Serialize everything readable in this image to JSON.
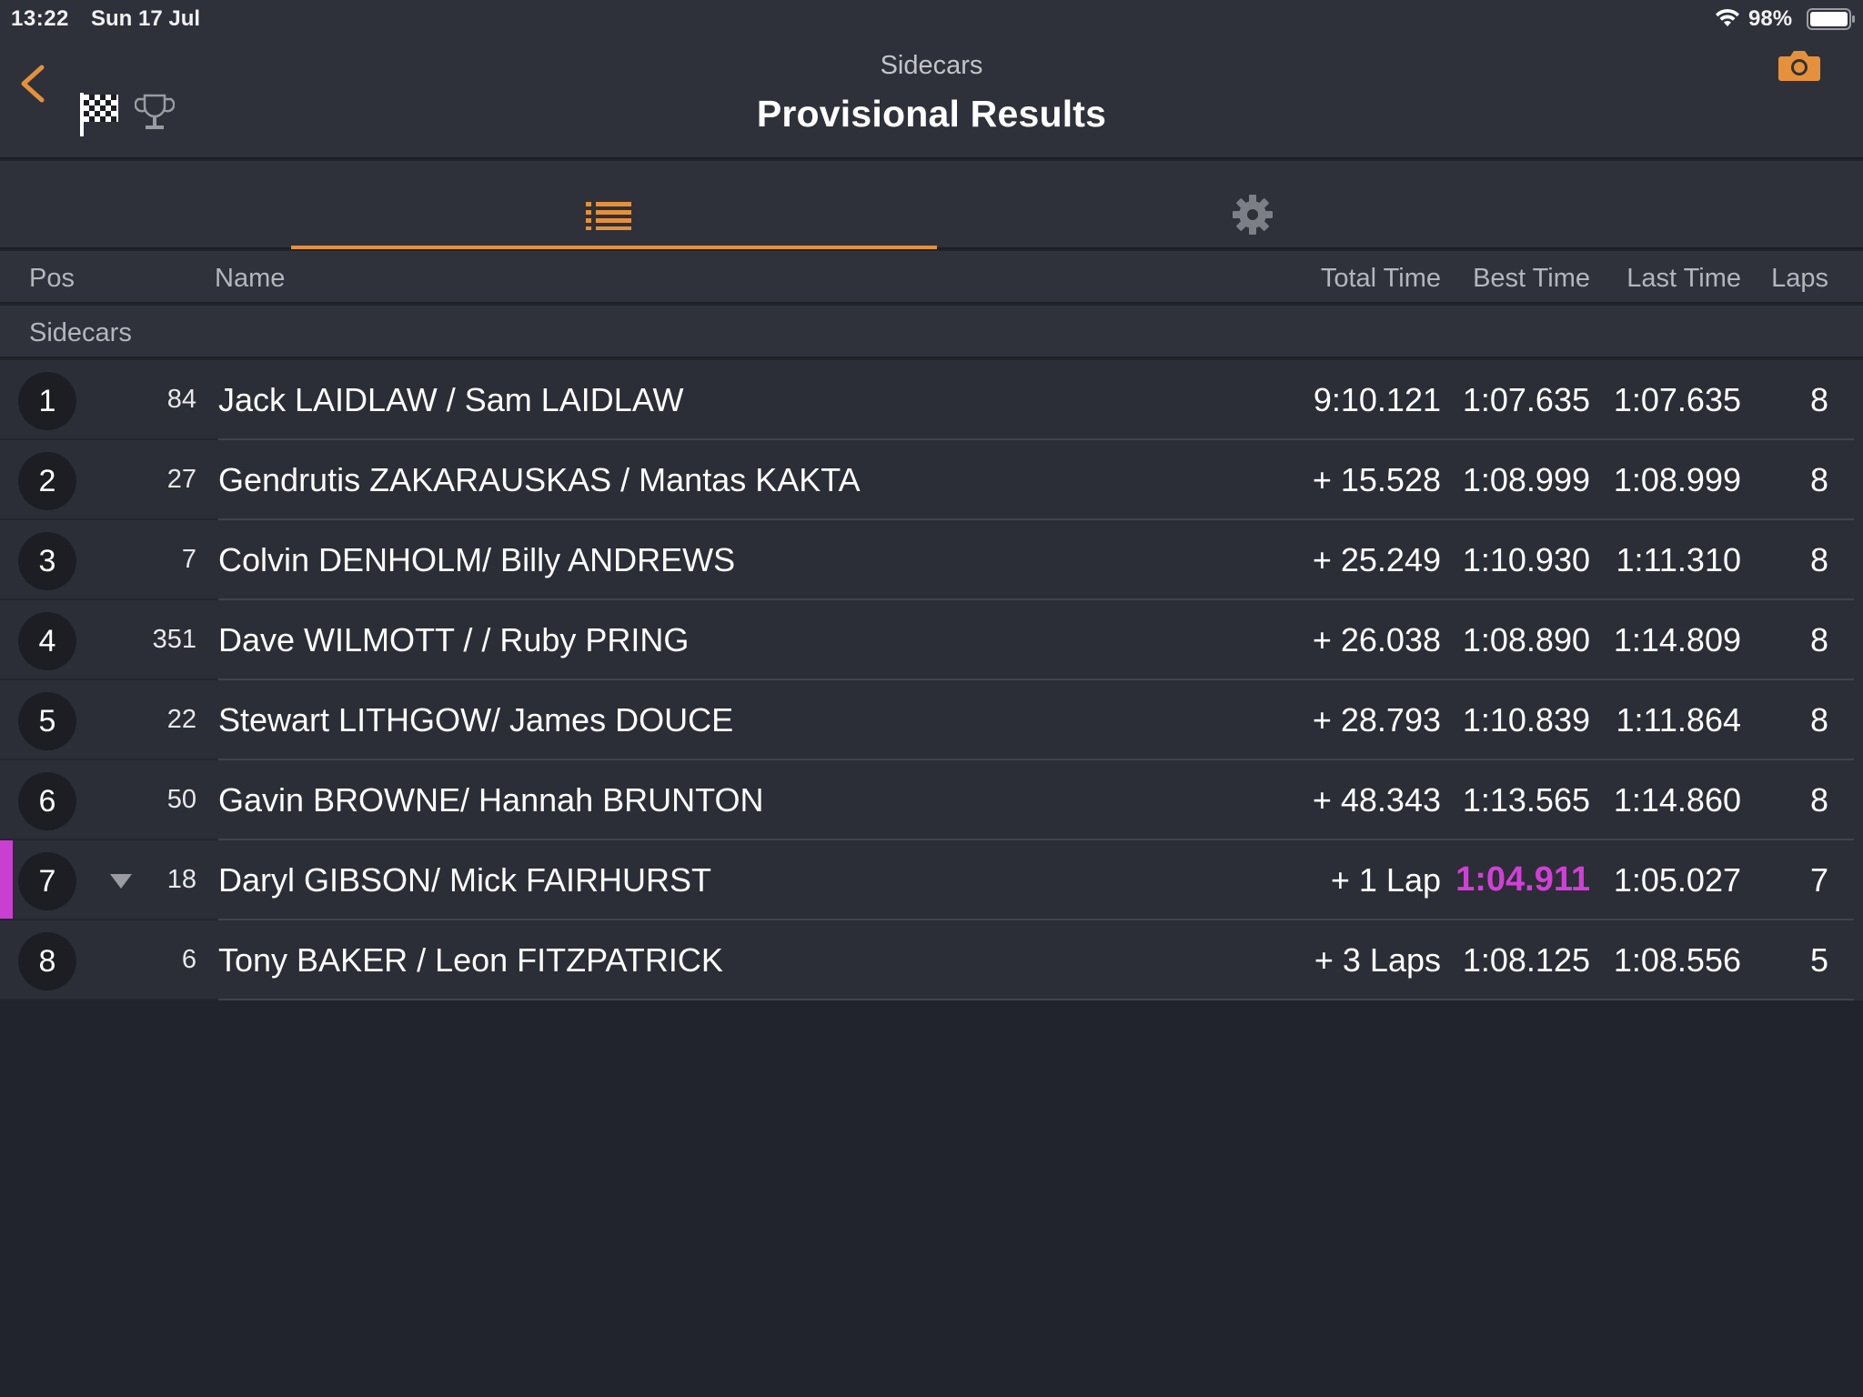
{
  "status_bar": {
    "time": "13:22",
    "date": "Sun 17 Jul",
    "battery": "98%"
  },
  "header": {
    "subtitle": "Sidecars",
    "title": "Provisional Results"
  },
  "colors": {
    "accent": "#e5913b",
    "fastest_lap": "#d23fd8",
    "background": "#21242c"
  },
  "columns": {
    "pos": "Pos",
    "name": "Name",
    "total_time": "Total Time",
    "best_time": "Best Time",
    "last_time": "Last Time",
    "laps": "Laps"
  },
  "group": "Sidecars",
  "results": [
    {
      "pos": "1",
      "number": "84",
      "name": "Jack LAIDLAW / Sam LAIDLAW",
      "total": "9:10.121",
      "best": "1:07.635",
      "last": "1:07.635",
      "laps": "8"
    },
    {
      "pos": "2",
      "number": "27",
      "name": "Gendrutis ZAKARAUSKAS / Mantas KAKTA",
      "total": "+ 15.528",
      "best": "1:08.999",
      "last": "1:08.999",
      "laps": "8"
    },
    {
      "pos": "3",
      "number": "7",
      "name": "Colvin DENHOLM/ Billy ANDREWS",
      "total": "+ 25.249",
      "best": "1:10.930",
      "last": "1:11.310",
      "laps": "8"
    },
    {
      "pos": "4",
      "number": "351",
      "name": "Dave WILMOTT / / Ruby PRING",
      "total": "+ 26.038",
      "best": "1:08.890",
      "last": "1:14.809",
      "laps": "8"
    },
    {
      "pos": "5",
      "number": "22",
      "name": "Stewart LITHGOW/ James DOUCE",
      "total": "+ 28.793",
      "best": "1:10.839",
      "last": "1:11.864",
      "laps": "8"
    },
    {
      "pos": "6",
      "number": "50",
      "name": "Gavin BROWNE/ Hannah BRUNTON",
      "total": "+ 48.343",
      "best": "1:13.565",
      "last": "1:14.860",
      "laps": "8"
    },
    {
      "pos": "7",
      "number": "18",
      "name": "Daryl GIBSON/ Mick FAIRHURST",
      "total": "+ 1 Lap",
      "best": "1:04.911",
      "last": "1:05.027",
      "laps": "7",
      "fastest": true,
      "trend": "down"
    },
    {
      "pos": "8",
      "number": "6",
      "name": "Tony BAKER / Leon FITZPATRICK",
      "total": "+ 3 Laps",
      "best": "1:08.125",
      "last": "1:08.556",
      "laps": "5"
    }
  ]
}
